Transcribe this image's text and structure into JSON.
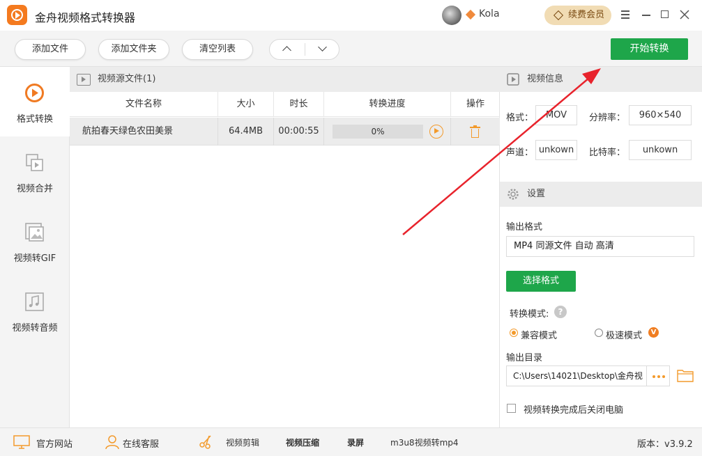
{
  "app": {
    "title": "金舟视频格式转换器"
  },
  "user": {
    "name": "Kola",
    "renew_label": "续费会员"
  },
  "toolbar": {
    "add_file": "添加文件",
    "add_folder": "添加文件夹",
    "clear_list": "清空列表",
    "start": "开始转换"
  },
  "sidebar": {
    "items": [
      {
        "label": "格式转换",
        "icon": "format-convert-icon",
        "active": true
      },
      {
        "label": "视频合并",
        "icon": "video-merge-icon",
        "active": false
      },
      {
        "label": "视频转GIF",
        "icon": "image-icon",
        "active": false
      },
      {
        "label": "视频转音频",
        "icon": "music-note-icon",
        "active": false
      }
    ]
  },
  "source": {
    "header": "视频源文件(1)",
    "columns": {
      "name": "文件名称",
      "size": "大小",
      "duration": "时长",
      "progress": "转换进度",
      "action": "操作"
    },
    "rows": [
      {
        "name": "航拍春天绿色农田美景",
        "size": "64.4MB",
        "duration": "00:00:55",
        "progress_label": "0%",
        "progress": 0
      }
    ]
  },
  "video_info": {
    "header": "视频信息",
    "format_label": "格式：",
    "format": "MOV",
    "resolution_label": "分辨率：",
    "resolution": "960×540",
    "channel_label": "声道：",
    "channel": "unkown",
    "bitrate_label": "比特率：",
    "bitrate": "unkown"
  },
  "settings": {
    "header": "设置",
    "output_format_label": "输出格式",
    "output_format": "MP4 同源文件 自动 高清",
    "select_format": "选择格式",
    "mode_label": "转换模式:",
    "mode_compat": "兼容模式",
    "mode_fast": "极速模式",
    "output_dir_label": "输出目录",
    "output_dir": "C:\\Users\\14021\\Desktop\\金舟视",
    "shutdown_label": "视频转换完成后关闭电脑"
  },
  "statusbar": {
    "website": "官方网站",
    "support": "在线客服",
    "edit": "视频剪辑",
    "compress": "视频压缩",
    "record": "录屏",
    "m3u8": "m3u8视频转mp4",
    "version": "版本：v3.9.2"
  },
  "colors": {
    "accent_green": "#1ea64a",
    "accent_orange": "#f39a2b",
    "annotation_red": "#e8232c"
  }
}
